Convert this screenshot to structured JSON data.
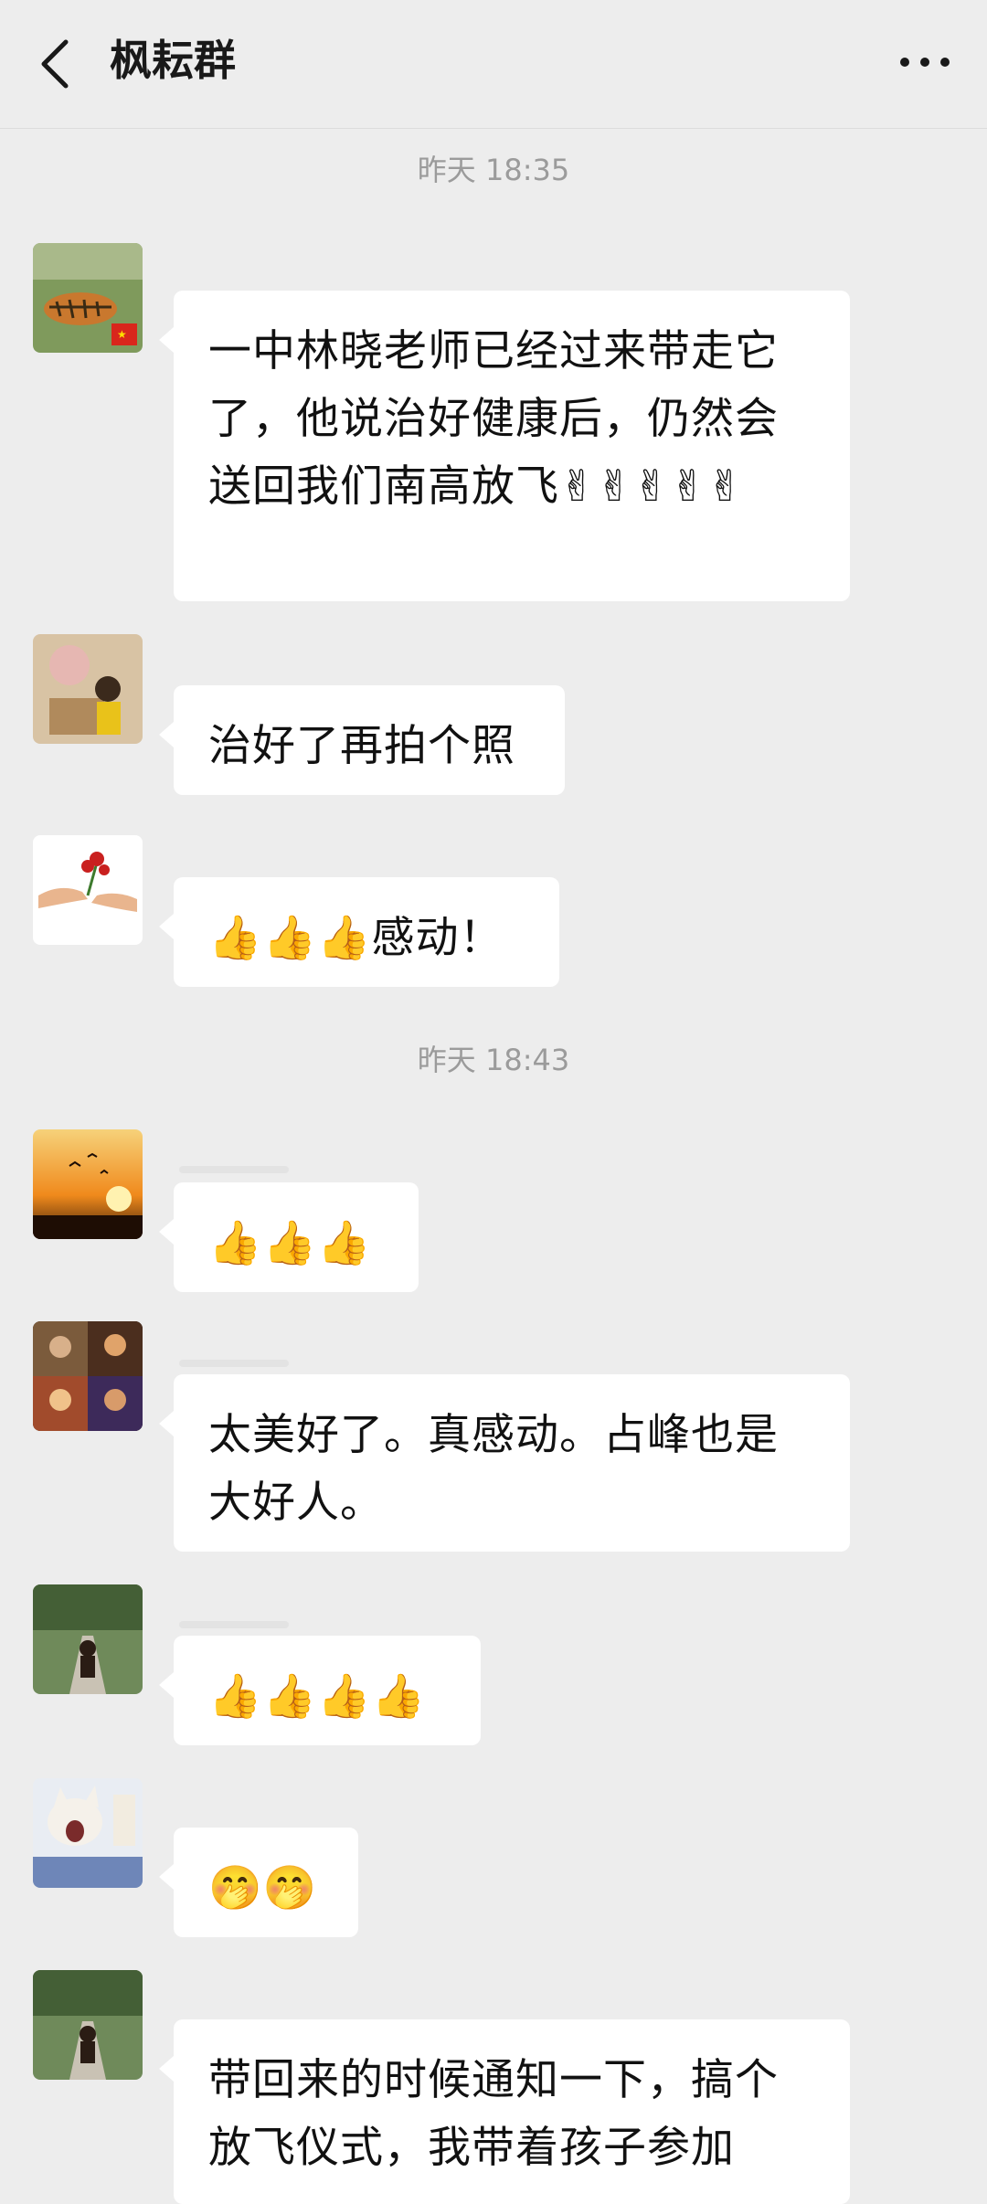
{
  "header": {
    "title": "枫耘群",
    "back_icon": "back-chevron-icon",
    "more_icon": "more-dots-icon"
  },
  "timestamps": [
    "昨天 18:35",
    "昨天 18:43"
  ],
  "messages": [
    {
      "text": "一中林晓老师已经过来带走它了，他说治好健康后，仍然会送回我们南高放飞✌✌✌✌✌"
    },
    {
      "text": "治好了再拍个照"
    },
    {
      "text": "👍👍👍感动！"
    },
    {
      "text": "👍👍👍"
    },
    {
      "text": "太美好了。真感动。占峰也是大好人。"
    },
    {
      "text": "👍👍👍👍"
    },
    {
      "text": "🤭🤭"
    },
    {
      "text": "带回来的时候通知一下，搞个放飞仪式，我带着孩子参加"
    }
  ],
  "colors": {
    "background": "#ededed",
    "bubble": "#ffffff",
    "timestamp": "#9b9b9b"
  }
}
